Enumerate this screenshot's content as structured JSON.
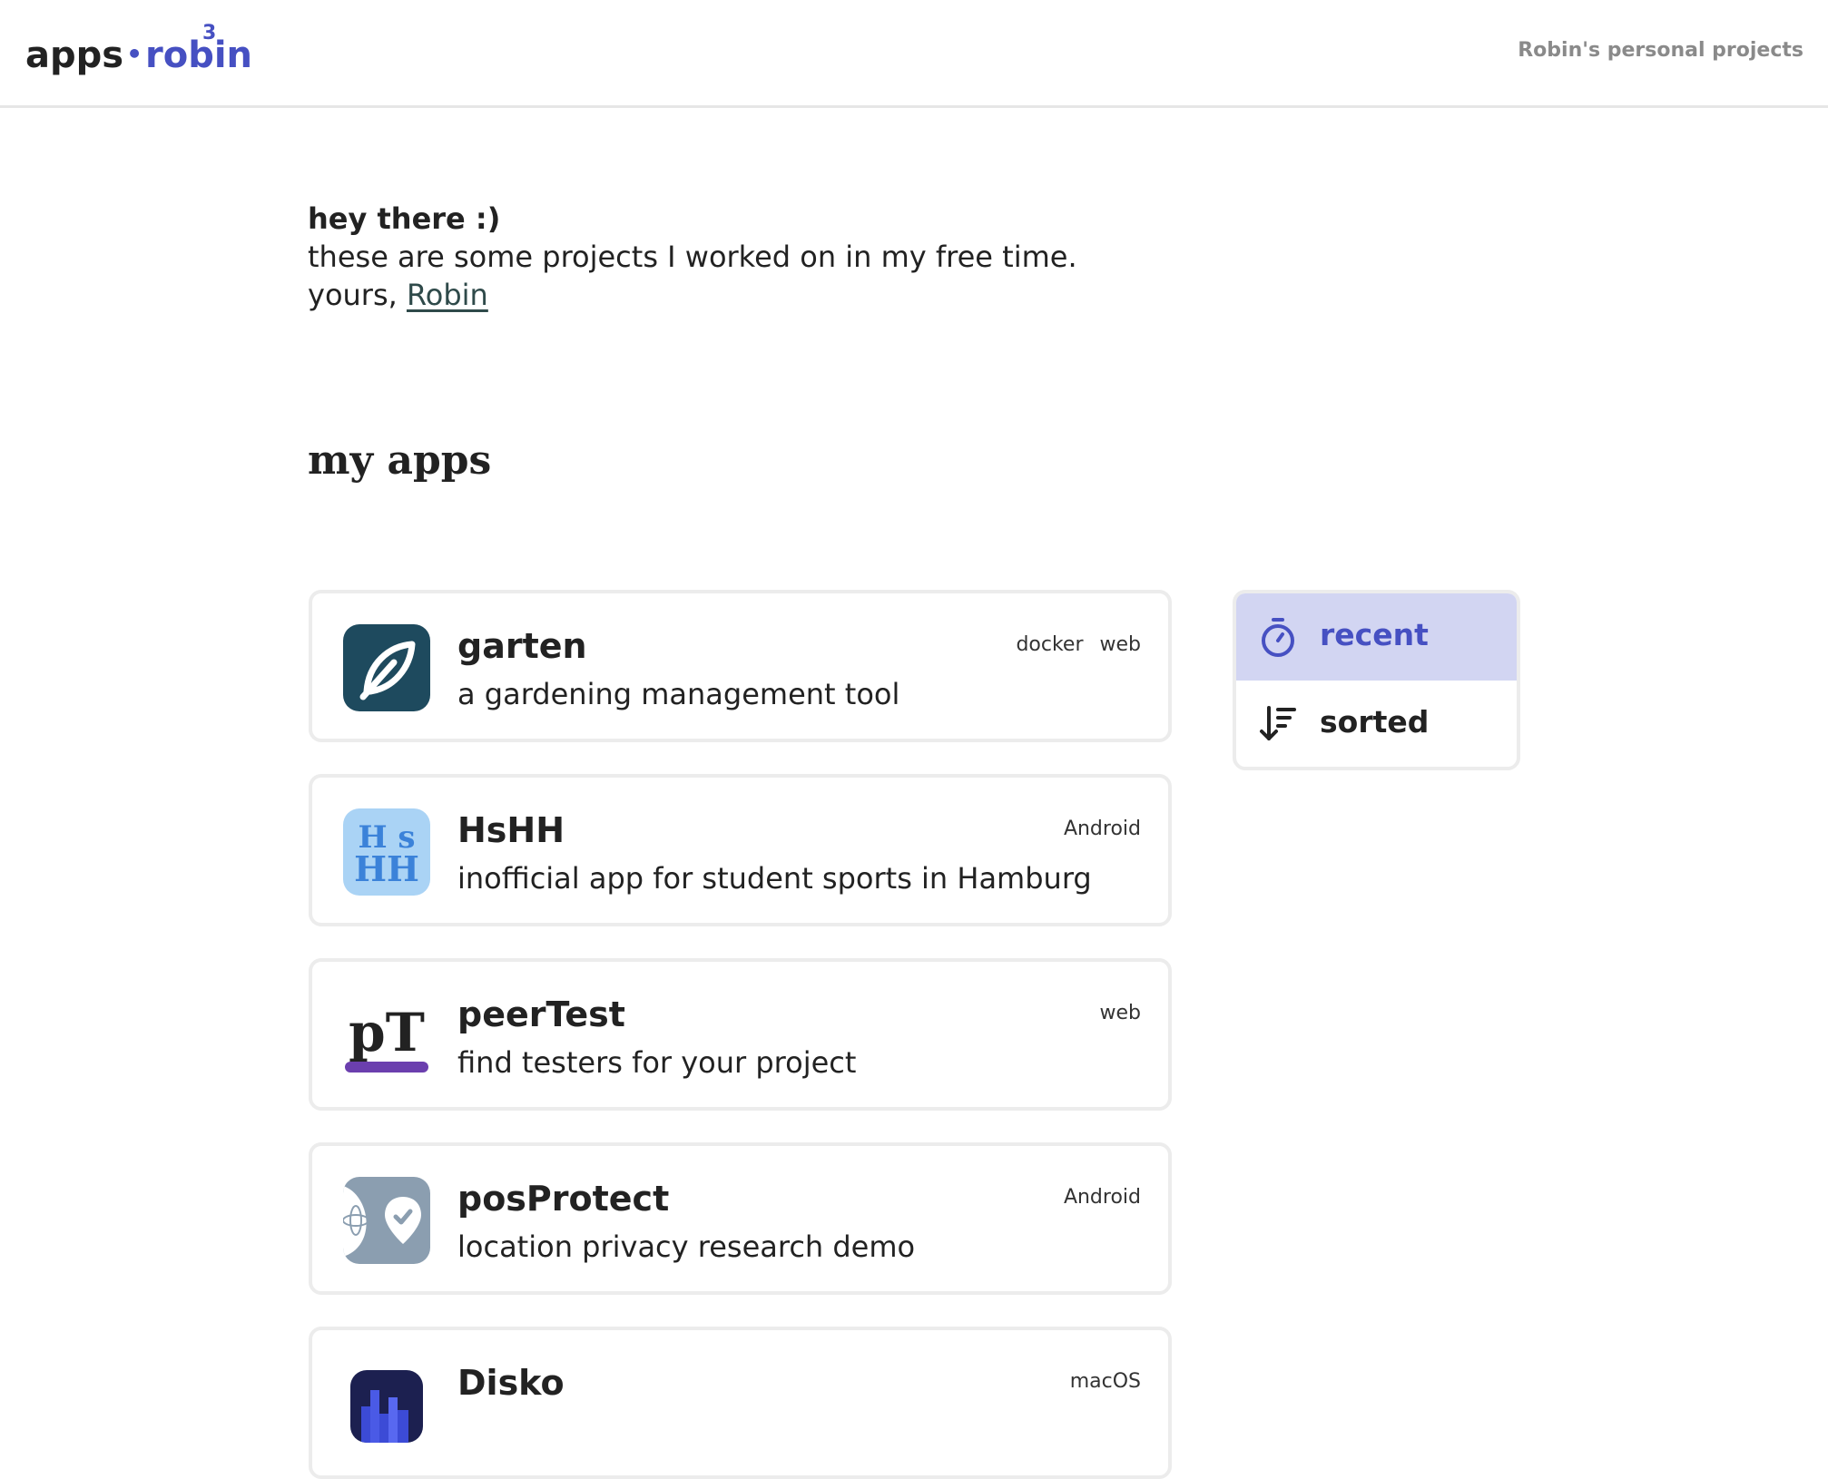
{
  "header": {
    "logo_apps": "apps",
    "logo_dot": "•",
    "logo_robin": "robin",
    "logo_sup": "3",
    "tagline": "Robin's personal projects"
  },
  "intro": {
    "greeting": "hey there :)",
    "line": "these are some projects I worked on in my free time.",
    "signoff": "yours,",
    "author_link": "Robin"
  },
  "section_title": "my apps",
  "apps": [
    {
      "name": "garten",
      "description": "a gardening management tool",
      "tags": [
        "docker",
        "web"
      ],
      "icon": "leaf-icon"
    },
    {
      "name": "HsHH",
      "description": "inofficial app for student sports in Hamburg",
      "tags": [
        "Android"
      ],
      "icon": "hshh-icon",
      "icon_text": [
        "H s",
        "HH"
      ]
    },
    {
      "name": "peerTest",
      "description": "find testers for your project",
      "tags": [
        "web"
      ],
      "icon": "pt-icon",
      "icon_text": "pT"
    },
    {
      "name": "posProtect",
      "description": "location privacy research demo",
      "tags": [
        "Android"
      ],
      "icon": "location-shield-icon"
    },
    {
      "name": "Disko",
      "description": "",
      "tags": [
        "macOS"
      ],
      "icon": "disko-icon"
    }
  ],
  "sort": {
    "options": [
      {
        "label": "recent",
        "icon": "stopwatch-icon",
        "active": true
      },
      {
        "label": "sorted",
        "icon": "sort-descending-icon",
        "active": false
      }
    ]
  },
  "colors": {
    "accent": "#4650c2",
    "active_bg": "#d2d5f2",
    "card_border": "#ececec",
    "garten_icon_bg": "#1e4a5e",
    "hshh_icon_bg": "#aad3f5",
    "peertest_bar": "#6b3fae",
    "posprotect_icon_bg": "#8b9eb0"
  }
}
